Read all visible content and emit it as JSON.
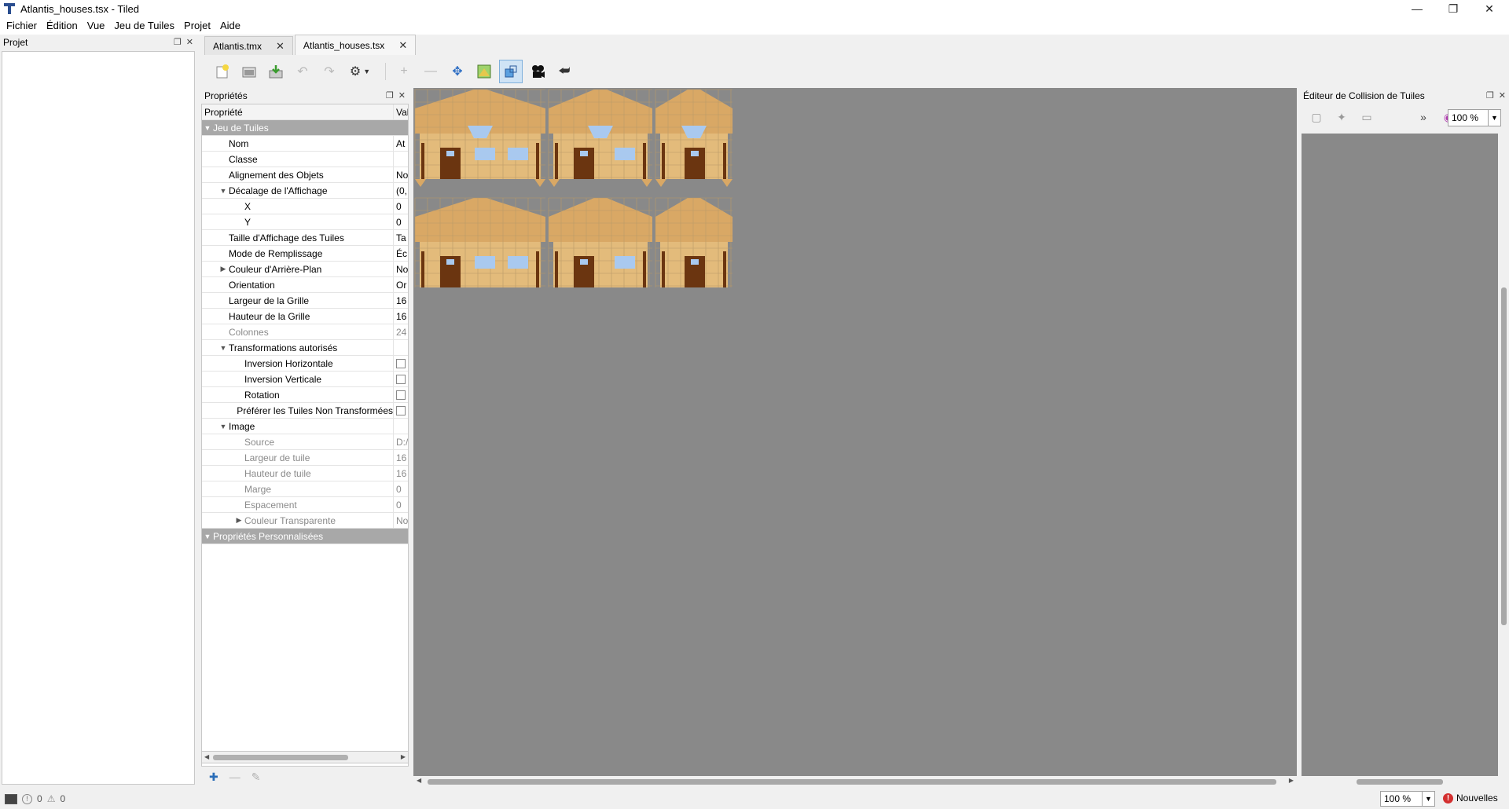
{
  "window": {
    "title": "Atlantis_houses.tsx - Tiled"
  },
  "menubar": {
    "items": [
      "Fichier",
      "Édition",
      "Vue",
      "Jeu de Tuiles",
      "Projet",
      "Aide"
    ]
  },
  "project_dock": {
    "title": "Projet"
  },
  "tabs": [
    {
      "label": "Atlantis.tmx",
      "active": false
    },
    {
      "label": "Atlantis_houses.tsx",
      "active": true
    }
  ],
  "toolbar": {
    "icons": [
      "new-tile-icon",
      "open-image-icon",
      "save-icon",
      "undo-icon",
      "redo-icon",
      "settings-icon",
      "add-tile-icon",
      "remove-tile-icon",
      "move-icon",
      "terrain-icon",
      "shape-icon",
      "animation-icon",
      "reload-icon"
    ]
  },
  "properties": {
    "title": "Propriétés",
    "header": {
      "name": "Propriété",
      "value": "Val"
    },
    "rows": [
      {
        "name": "Jeu de Tuiles",
        "value": "",
        "level": 0,
        "kind": "group",
        "arrow": "▼"
      },
      {
        "name": "Nom",
        "value": "At",
        "level": 1,
        "kind": "row",
        "arrow": ""
      },
      {
        "name": "Classe",
        "value": "",
        "level": 1,
        "kind": "row",
        "arrow": ""
      },
      {
        "name": "Alignement des Objets",
        "value": "No",
        "level": 1,
        "kind": "row",
        "arrow": ""
      },
      {
        "name": "Décalage de l'Affichage",
        "value": "(0,",
        "level": 1,
        "kind": "row",
        "arrow": "▼"
      },
      {
        "name": "X",
        "value": "0",
        "level": 2,
        "kind": "row",
        "arrow": ""
      },
      {
        "name": "Y",
        "value": "0",
        "level": 2,
        "kind": "row",
        "arrow": ""
      },
      {
        "name": "Taille d'Affichage des Tuiles",
        "value": "Ta",
        "level": 1,
        "kind": "row",
        "arrow": ""
      },
      {
        "name": "Mode de Remplissage",
        "value": "Éc",
        "level": 1,
        "kind": "row",
        "arrow": ""
      },
      {
        "name": "Couleur d'Arrière-Plan",
        "value": "No",
        "level": 1,
        "kind": "row",
        "arrow": "▶"
      },
      {
        "name": "Orientation",
        "value": "Or",
        "level": 1,
        "kind": "row",
        "arrow": ""
      },
      {
        "name": "Largeur de la Grille",
        "value": "16",
        "level": 1,
        "kind": "row",
        "arrow": ""
      },
      {
        "name": "Hauteur de la Grille",
        "value": "16",
        "level": 1,
        "kind": "row",
        "arrow": ""
      },
      {
        "name": "Colonnes",
        "value": "24",
        "level": 1,
        "kind": "disabled",
        "arrow": ""
      },
      {
        "name": "Transformations autorisés",
        "value": "",
        "level": 1,
        "kind": "row",
        "arrow": "▼"
      },
      {
        "name": "Inversion Horizontale",
        "value": "",
        "level": 2,
        "kind": "checkbox",
        "arrow": ""
      },
      {
        "name": "Inversion Verticale",
        "value": "",
        "level": 2,
        "kind": "checkbox",
        "arrow": ""
      },
      {
        "name": "Rotation",
        "value": "",
        "level": 2,
        "kind": "checkbox",
        "arrow": ""
      },
      {
        "name": "Préférer les Tuiles Non Transformées",
        "value": "",
        "level": 2,
        "kind": "checkbox",
        "arrow": ""
      },
      {
        "name": "Image",
        "value": "",
        "level": 1,
        "kind": "row",
        "arrow": "▼"
      },
      {
        "name": "Source",
        "value": "D:/",
        "level": 2,
        "kind": "disabled",
        "arrow": ""
      },
      {
        "name": "Largeur de tuile",
        "value": "16",
        "level": 2,
        "kind": "disabled",
        "arrow": ""
      },
      {
        "name": "Hauteur de tuile",
        "value": "16",
        "level": 2,
        "kind": "disabled",
        "arrow": ""
      },
      {
        "name": "Marge",
        "value": "0",
        "level": 2,
        "kind": "disabled",
        "arrow": ""
      },
      {
        "name": "Espacement",
        "value": "0",
        "level": 2,
        "kind": "disabled",
        "arrow": ""
      },
      {
        "name": "Couleur Transparente",
        "value": "No",
        "level": 2,
        "kind": "disabled",
        "arrow": "▶"
      },
      {
        "name": "Propriétés Personnalisées",
        "value": "",
        "level": 0,
        "kind": "group",
        "arrow": "▼"
      }
    ]
  },
  "tileset": {
    "houses": [
      {
        "size": "large",
        "row": 0
      },
      {
        "size": "medium",
        "row": 0
      },
      {
        "size": "small",
        "row": 0
      },
      {
        "size": "large",
        "row": 1
      },
      {
        "size": "medium",
        "row": 1
      },
      {
        "size": "small",
        "row": 1
      }
    ],
    "colors": {
      "wall": "#e3bb7b",
      "roof": "#d9a865",
      "door": "#6b3510",
      "window": "#a9c9ef",
      "background": "#898989"
    }
  },
  "collision_editor": {
    "title": "Éditeur de Collision de Tuiles",
    "zoom": "100 %"
  },
  "statusbar": {
    "errors": "0",
    "warnings": "0",
    "zoom": "100 %",
    "news": "Nouvelles"
  }
}
